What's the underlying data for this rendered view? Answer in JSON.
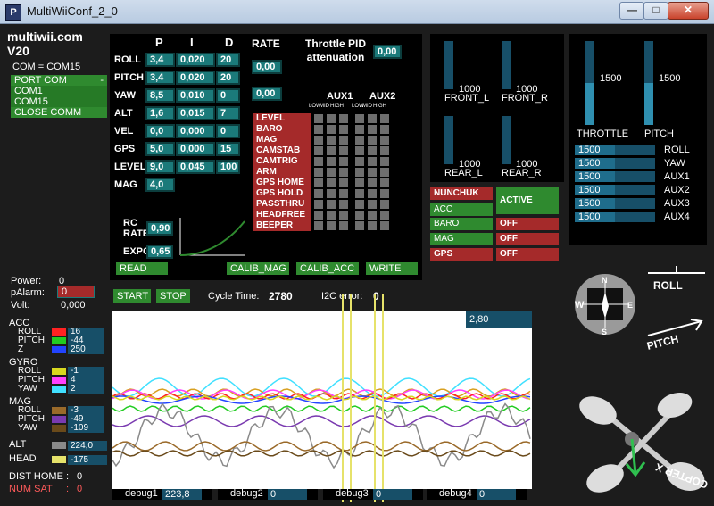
{
  "window": {
    "title": "MultiWiiConf_2_0",
    "app_icon_text": "P",
    "min": "—",
    "max": "□",
    "close": "✕"
  },
  "brand": {
    "name": "multiwii.com",
    "version": "V20"
  },
  "com": {
    "label": "COM = COM15",
    "port_header": "PORT COM",
    "port_arrow": "-",
    "ports": [
      "COM1",
      "COM15"
    ],
    "close": "CLOSE COMM"
  },
  "pid": {
    "headers": {
      "p": "P",
      "i": "I",
      "d": "D",
      "rate": "RATE"
    },
    "rows": [
      {
        "name": "ROLL",
        "p": "3,4",
        "i": "0,020",
        "d": "20"
      },
      {
        "name": "PITCH",
        "p": "3,4",
        "i": "0,020",
        "d": "20"
      },
      {
        "name": "YAW",
        "p": "8,5",
        "i": "0,010",
        "d": "0"
      },
      {
        "name": "ALT",
        "p": "1,6",
        "i": "0,015",
        "d": "7"
      },
      {
        "name": "VEL",
        "p": "0,0",
        "i": "0,000",
        "d": "0"
      },
      {
        "name": "GPS",
        "p": "5,0",
        "i": "0,000",
        "d": "15"
      },
      {
        "name": "LEVEL",
        "p": "9,0",
        "i": "0,045",
        "d": "100"
      },
      {
        "name": "MAG",
        "p": "4,0",
        "i": "",
        "d": ""
      }
    ],
    "rate_rollpitch": "0,00",
    "rate_yaw": "0,00",
    "throttle_pid_label": "Throttle PID attenuation",
    "throttle_pid_value": "0,00",
    "rc_rate_label": "RC RATE",
    "rc_rate_value": "0,90",
    "expo_label": "EXPO",
    "expo_value": "0,65"
  },
  "aux": {
    "aux1": "AUX1",
    "aux2": "AUX2",
    "sub": [
      "LOW",
      "MID",
      "HIGH",
      "LOW",
      "MID",
      "HIGH"
    ],
    "modes": [
      "LEVEL",
      "BARO",
      "MAG",
      "CAMSTAB",
      "CAMTRIG",
      "ARM",
      "GPS HOME",
      "GPS HOLD",
      "PASSTHRU",
      "HEADFREE",
      "BEEPER"
    ]
  },
  "buttons": {
    "read": "READ",
    "calib_mag": "CALIB_MAG",
    "calib_acc": "CALIB_ACC",
    "write": "WRITE",
    "start": "START",
    "stop": "STOP"
  },
  "motors": [
    {
      "label": "FRONT_L",
      "value": "1000"
    },
    {
      "label": "FRONT_R",
      "value": "1000"
    },
    {
      "label": "REAR_L",
      "value": "1000"
    },
    {
      "label": "REAR_R",
      "value": "1000"
    }
  ],
  "sensors_status": {
    "nunchuk": "NUNCHUK",
    "active": "ACTIVE",
    "acc": "ACC",
    "baro": "BARO",
    "baro_state": "OFF",
    "mag": "MAG",
    "mag_state": "OFF",
    "gps": "GPS",
    "gps_state": "OFF"
  },
  "rc": {
    "throttle_label": "THROTTLE",
    "throttle_value": "1500",
    "pitch_label": "PITCH",
    "pitch_value": "1500",
    "channels": [
      {
        "name": "ROLL",
        "value": "1500"
      },
      {
        "name": "YAW",
        "value": "1500"
      },
      {
        "name": "AUX1",
        "value": "1500"
      },
      {
        "name": "AUX2",
        "value": "1500"
      },
      {
        "name": "AUX3",
        "value": "1500"
      },
      {
        "name": "AUX4",
        "value": "1500"
      }
    ]
  },
  "status": {
    "power_label": "Power:",
    "power_value": "0",
    "palarm_label": "pAlarm:",
    "palarm_value": "0",
    "volt_label": "Volt:",
    "volt_value": "0,000",
    "cycle_label": "Cycle Time:",
    "cycle_value": "2780",
    "i2c_label": "I2C error:",
    "i2c_value": "0"
  },
  "sensors": {
    "acc": {
      "label": "ACC",
      "roll": "16",
      "pitch": "-44",
      "z": "250"
    },
    "gyro": {
      "label": "GYRO",
      "roll": "-1",
      "pitch": "4",
      "yaw": "2"
    },
    "mag": {
      "label": "MAG",
      "roll": "-3",
      "pitch": "-49",
      "yaw": "-109"
    },
    "alt_label": "ALT",
    "alt_value": "224,0",
    "head_label": "HEAD",
    "head_value": "-175",
    "axis_roll": "ROLL",
    "axis_pitch": "PITCH",
    "axis_z": "Z",
    "axis_yaw": "YAW",
    "dist_home_label": "DIST HOME :",
    "dist_home_value": "0",
    "num_sat_label": "NUM SAT",
    "num_sat_colon": ":",
    "num_sat_value": "0"
  },
  "graph": {
    "scale_value": "2,80"
  },
  "debug": [
    {
      "label": "debug1",
      "value": "223,8"
    },
    {
      "label": "debug2",
      "value": "0"
    },
    {
      "label": "debug3",
      "value": "0"
    },
    {
      "label": "debug4",
      "value": "0"
    }
  ],
  "compass": {
    "n": "N",
    "s": "S",
    "e": "E",
    "w": "W"
  },
  "attitude": {
    "roll": "ROLL",
    "pitch": "PITCH",
    "quad": "COPTER X"
  },
  "colors": {
    "teal": "#1b7a7a",
    "green": "#2f8a2f",
    "red": "#a52a2a"
  }
}
